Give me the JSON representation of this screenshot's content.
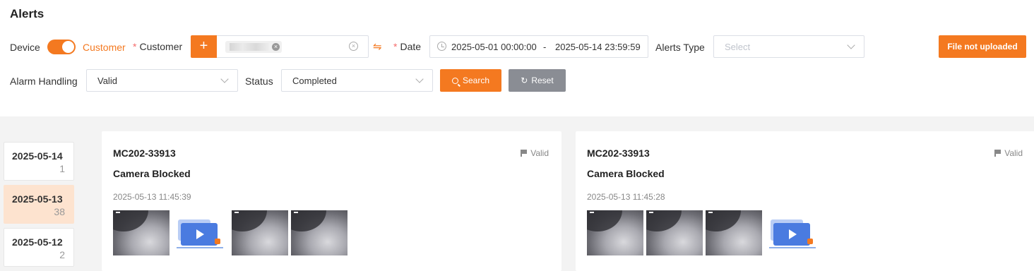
{
  "page": {
    "title": "Alerts"
  },
  "filters": {
    "device_label": "Device",
    "customer_toggle_label": "Customer",
    "required_mark": "*",
    "customer_label": "Customer",
    "add_symbol": "+",
    "date_label": "Date",
    "date_start": "2025-05-01 00:00:00",
    "date_separator": "-",
    "date_end": "2025-05-14 23:59:59",
    "alerts_type_label": "Alerts Type",
    "alerts_type_placeholder": "Select",
    "alarm_handling_label": "Alarm Handling",
    "alarm_handling_value": "Valid",
    "status_label": "Status",
    "status_value": "Completed",
    "search_label": "Search",
    "reset_label": "Reset",
    "file_button_label": "File not uploaded",
    "toggle_on": true
  },
  "colors": {
    "accent": "#f47920",
    "active_date_bg": "#fde3cf"
  },
  "dates": [
    {
      "date": "2025-05-14",
      "count": "1"
    },
    {
      "date": "2025-05-13",
      "count": "38",
      "active": true
    },
    {
      "date": "2025-05-12",
      "count": "2"
    }
  ],
  "alerts": [
    {
      "device": "MC202-33913",
      "type": "Camera Blocked",
      "time": "2025-05-13 11:45:39",
      "status": "Valid",
      "media": [
        "image",
        "video",
        "image",
        "image"
      ]
    },
    {
      "device": "MC202-33913",
      "type": "Camera Blocked",
      "time": "2025-05-13 11:45:28",
      "status": "Valid",
      "media": [
        "image",
        "image",
        "image",
        "video"
      ]
    }
  ]
}
